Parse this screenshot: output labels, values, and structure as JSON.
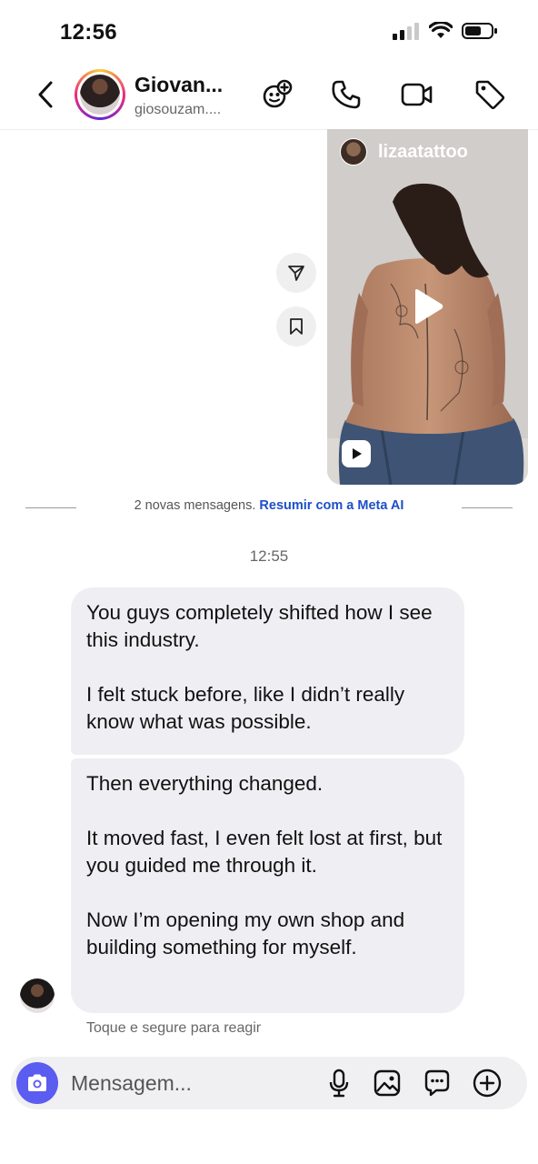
{
  "status_bar": {
    "time": "12:56"
  },
  "header": {
    "contact_name": "Giovan...",
    "contact_handle": "giosouzam...."
  },
  "shared_reel": {
    "username": "lizaatattoo"
  },
  "divider": {
    "text": "2 novas mensagens.",
    "link": "Resumir com a Meta AI"
  },
  "timestamp": "12:55",
  "messages": [
    {
      "paragraphs": [
        "You guys completely shifted how I see this industry.",
        "I felt stuck before, like I didn’t really know what was possible."
      ]
    },
    {
      "paragraphs": [
        "Then everything changed.",
        "It moved fast, I even felt lost at first, but you guided me through it.",
        "Now I’m opening my own shop and building something for myself."
      ]
    }
  ],
  "hold_hint": "Toque e segure para reagir",
  "composer": {
    "placeholder": "Mensagem..."
  },
  "colors": {
    "accent": "#5b5cf0",
    "link": "#1d4fc6",
    "bubble": "#efeff3"
  }
}
